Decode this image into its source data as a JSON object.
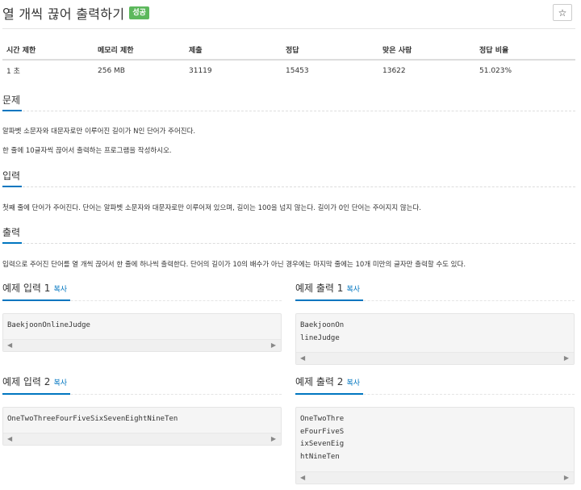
{
  "problem": {
    "title": "열 개씩 끊어 출력하기",
    "badge": "성공",
    "star_icon": "star-icon"
  },
  "info": {
    "headers": [
      "시간 제한",
      "메모리 제한",
      "제출",
      "정답",
      "맞은 사람",
      "정답 비율"
    ],
    "values": [
      "1 초",
      "256 MB",
      "31119",
      "15453",
      "13622",
      "51.023%"
    ]
  },
  "sections": {
    "description": {
      "title": "문제",
      "lines": [
        "알파벳 소문자와 대문자로만 이루어진 길이가 N인 단어가 주어진다.",
        "한 줄에 10글자씩 끊어서 출력하는 프로그램을 작성하시오."
      ]
    },
    "input": {
      "title": "입력",
      "lines": [
        "첫째 줄에 단어가 주어진다. 단어는 알파벳 소문자와 대문자로만 이루어져 있으며, 길이는 100을 넘지 않는다. 길이가 0인 단어는 주어지지 않는다."
      ]
    },
    "output": {
      "title": "출력",
      "lines": [
        "입력으로 주어진 단어를 열 개씩 끊어서 한 줄에 하나씩 출력한다. 단어의 길이가 10의 배수가 아닌 경우에는 마지막 줄에는 10개 미만의 글자만 출력할 수도 있다."
      ]
    }
  },
  "samples": {
    "copy_label": "복사",
    "in1": {
      "title": "예제 입력 1",
      "code": "BaekjoonOnlineJudge"
    },
    "out1": {
      "title": "예제 출력 1",
      "code": "BaekjoonOn\nlineJudge"
    },
    "in2": {
      "title": "예제 입력 2",
      "code": "OneTwoThreeFourFiveSixSevenEightNineTen"
    },
    "out2": {
      "title": "예제 출력 2",
      "code": "OneTwoThre\neFourFiveS\nixSevenEig\nhtNineTen"
    }
  },
  "scroll_arrows": {
    "left": "◀",
    "right": "▶"
  },
  "colors": {
    "accent": "#0076c0",
    "success": "#5cb85c"
  }
}
